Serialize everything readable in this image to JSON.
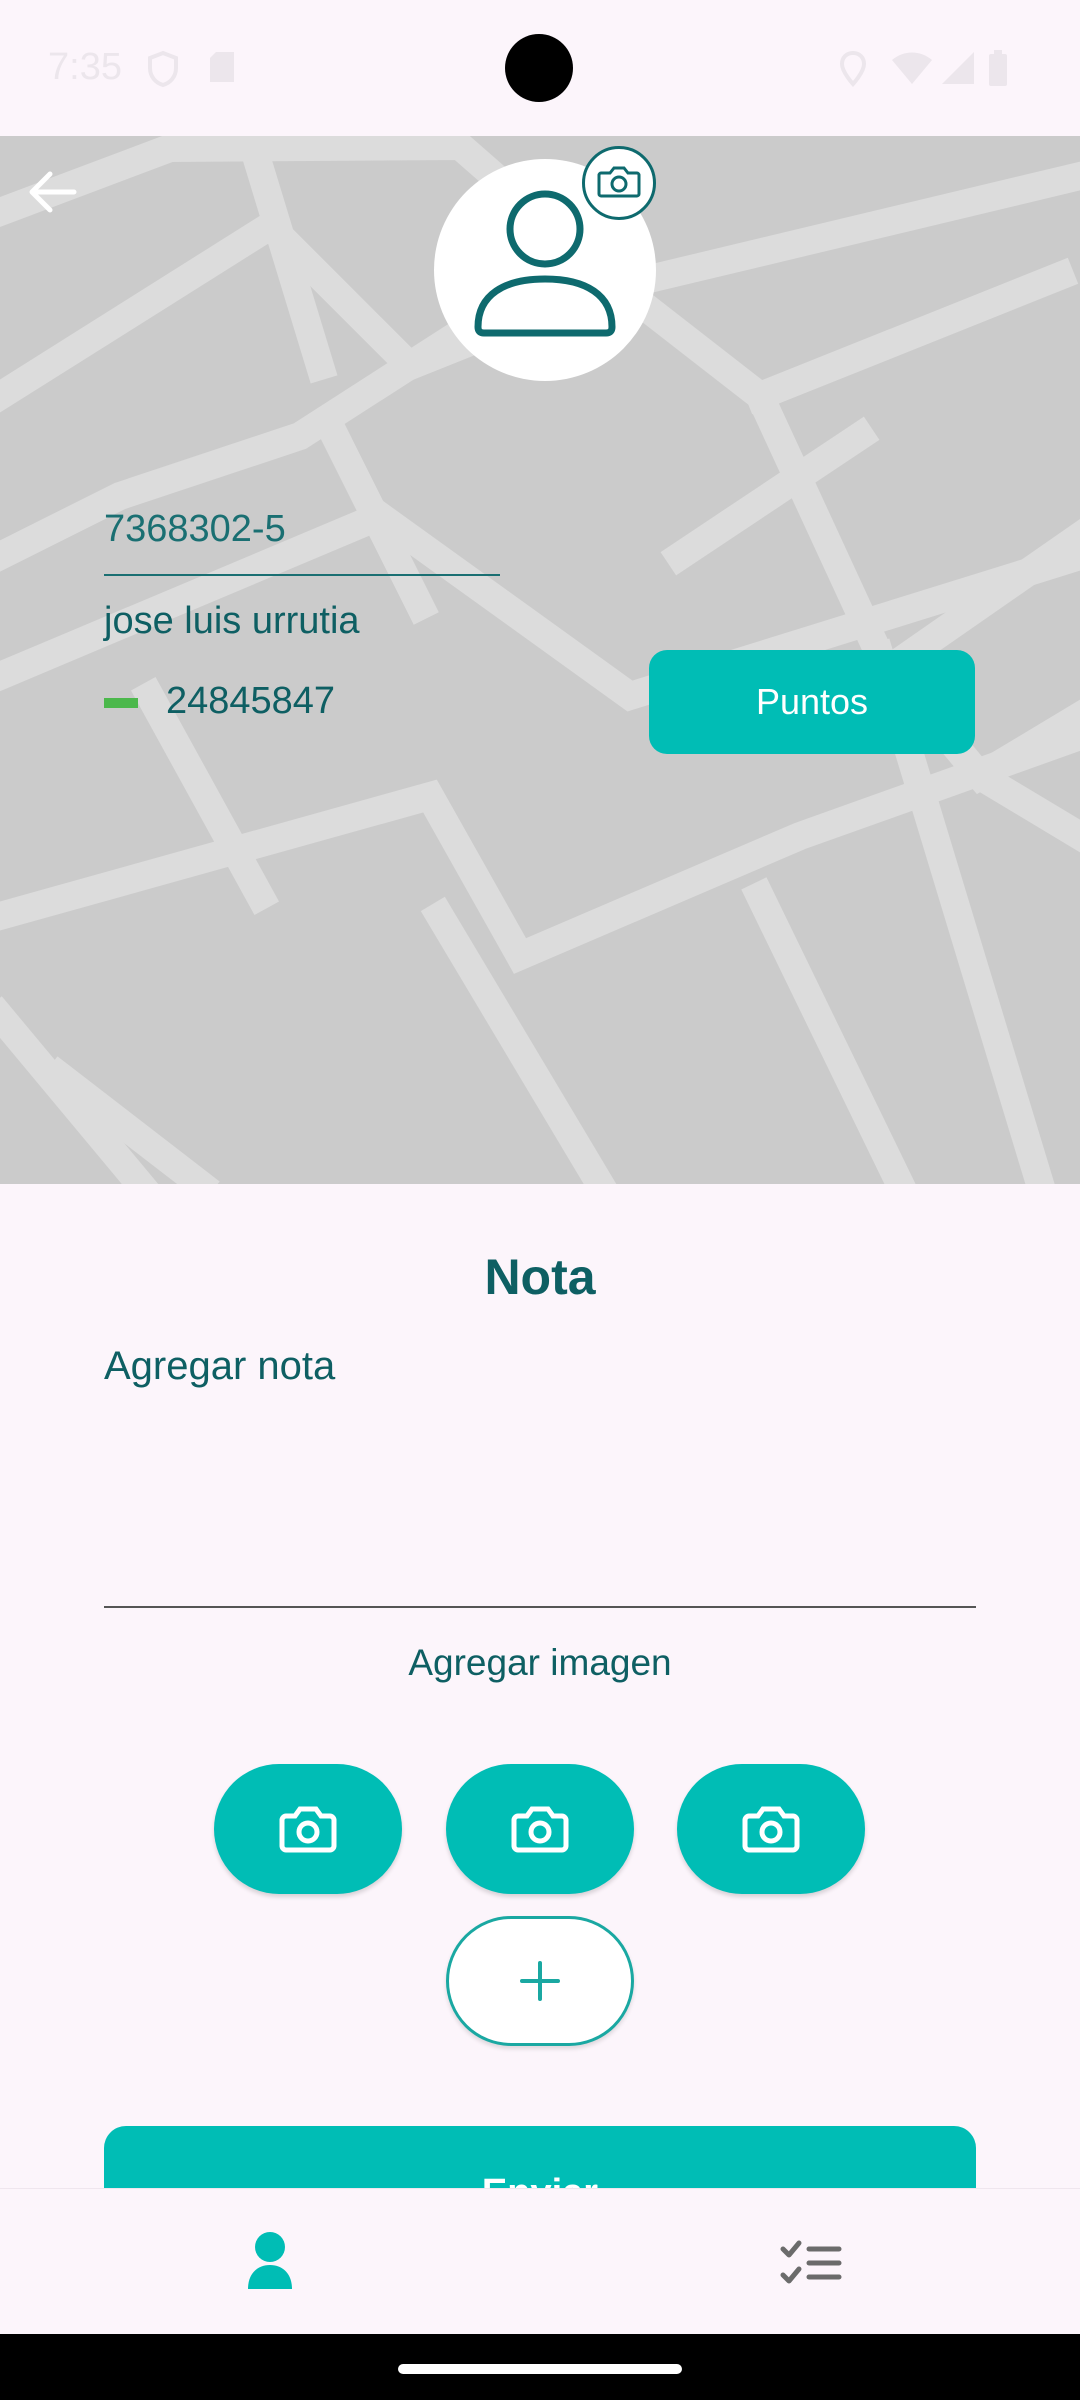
{
  "status_bar": {
    "time": "7:35"
  },
  "profile": {
    "rut": "7368302-5",
    "name": "jose luis urrutia",
    "phone": "24845847",
    "status_color": "#4cb84c",
    "points_button": "Puntos"
  },
  "note": {
    "title": "Nota",
    "note_label": "Agregar nota",
    "image_label": "Agregar imagen",
    "send_button": "Enviar"
  },
  "icons": {
    "back": "arrow-left-icon",
    "photo": "camera-icon",
    "add": "plus-icon",
    "nav_profile": "person-icon",
    "nav_tasks": "checklist-icon"
  },
  "colors": {
    "accent": "#00bdb5",
    "text": "#0e5f63",
    "map_background": "#cbcbcb",
    "page_background": "#fcf5fb"
  }
}
